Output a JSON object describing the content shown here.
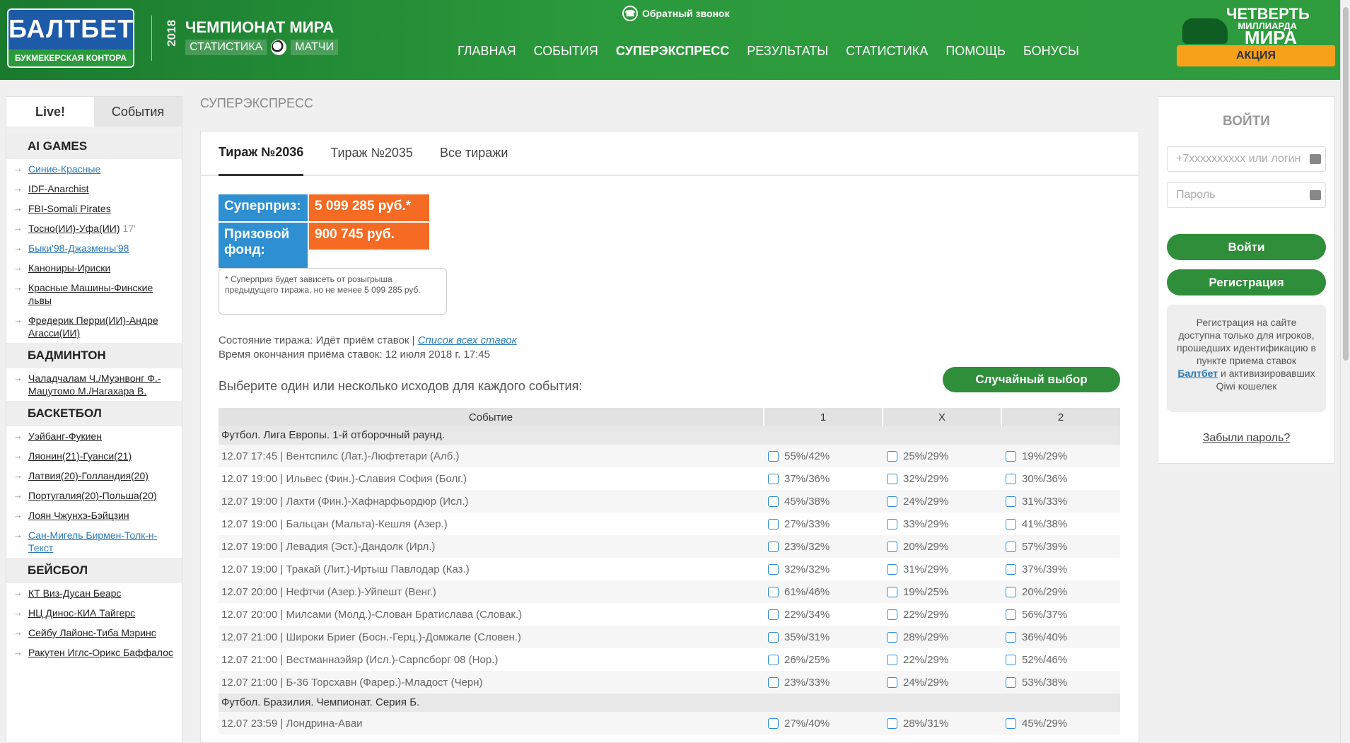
{
  "header": {
    "logo_text": "БАЛТБЕТ",
    "logo_sub": "БУКМЕКЕРСКАЯ КОНТОРА",
    "wc_year": "2018",
    "wc_title": "ЧЕМПИОНАТ МИРА",
    "wc_stats": "СТАТИСТИКА",
    "wc_matches": "МАТЧИ",
    "callback": "Обратный звонок",
    "nav": [
      "ГЛАВНАЯ",
      "СОБЫТИЯ",
      "СУПЕРЭКСПРЕСС",
      "РЕЗУЛЬТАТЫ",
      "СТАТИСТИКА",
      "ПОМОЩЬ",
      "БОНУСЫ"
    ],
    "promo_line1": "ЧЕТВЕРТЬ",
    "promo_line2": "МИЛЛИАРДА",
    "promo_line3": "МИРА",
    "promo_button": "АКЦИЯ"
  },
  "sidebar": {
    "tab_live": "Live!",
    "tab_events": "События",
    "sections": [
      {
        "title": "AI GAMES",
        "items": [
          {
            "label": "Синие-Красные",
            "live": true
          },
          {
            "label": "IDF-Anarchist"
          },
          {
            "label": "FBI-Somali Pirates"
          },
          {
            "label": "Тосно(ИИ)-Уфа(ИИ)",
            "min": "17'"
          },
          {
            "label": "Быки'98-Джазмены'98",
            "live": true
          },
          {
            "label": "Канониры-Ириски"
          },
          {
            "label": "Красные Машины-Финские львы"
          },
          {
            "label": "Фредерик Перри(ИИ)-Андре Агасси(ИИ)"
          }
        ]
      },
      {
        "title": "БАДМИНТОН",
        "items": [
          {
            "label": "Чаладчалам Ч./Муэнвонг Ф.-Мацутомо М./Нагахара В."
          }
        ]
      },
      {
        "title": "БАСКЕТБОЛ",
        "items": [
          {
            "label": "Уэйбанг-Фукиен"
          },
          {
            "label": "Ляонин(21)-Гуанси(21)"
          },
          {
            "label": "Латвия(20)-Голландия(20)"
          },
          {
            "label": "Португалия(20)-Польша(20)"
          },
          {
            "label": "Лоян Чжунхэ-Бэйцзин"
          },
          {
            "label": "Сан-Мигель Бирмен-Толк-н-Текст",
            "live": true
          }
        ]
      },
      {
        "title": "БЕЙСБОЛ",
        "items": [
          {
            "label": "КТ Виз-Дусан Беарс"
          },
          {
            "label": "НЦ Динос-КИА Тайгерс"
          },
          {
            "label": "Сейбу Лайонс-Тиба Мэринс"
          },
          {
            "label": "Ракутен Иглс-Орикс Баффалос"
          }
        ]
      }
    ]
  },
  "main": {
    "breadcrumb": "СУПЕРЭКСПРЕСС",
    "tabs": [
      "Тираж №2036",
      "Тираж №2035",
      "Все тиражи"
    ],
    "superprize_label": "Суперприз:",
    "superprize_value": "5 099 285 руб.*",
    "fund_label": "Призовой фонд:",
    "fund_value": "900 745 руб.",
    "prize_note": "* Суперприз будет зависеть от розыгрыша предыдущего тиража, но не менее 5 099 285 руб.",
    "state_text": "Состояние тиража: Идёт приём ставок | ",
    "state_link": "Список всех ставок",
    "deadline": "Время окончания приёма ставок: 12 июля 2018 г. 17:45",
    "choose_text": "Выберите один или несколько исходов для каждого события:",
    "random_button": "Случайный выбор",
    "columns": [
      "Событие",
      "1",
      "X",
      "2"
    ],
    "groups": [
      {
        "title": "Футбол. Лига Европы. 1-й отборочный раунд.",
        "rows": [
          {
            "event": "12.07 17:45 | Вентспилс (Лат.)-Люфтетари (Алб.)",
            "o1": "55%/42%",
            "ox": "25%/29%",
            "o2": "19%/29%"
          },
          {
            "event": "12.07 19:00 | Ильвес (Фин.)-Славия София (Болг.)",
            "o1": "37%/36%",
            "ox": "32%/29%",
            "o2": "30%/36%"
          },
          {
            "event": "12.07 19:00 | Лахти (Фин.)-Хафнарфьордюр (Исл.)",
            "o1": "45%/38%",
            "ox": "24%/29%",
            "o2": "31%/33%"
          },
          {
            "event": "12.07 19:00 | Бальцан (Мальта)-Кешля (Азер.)",
            "o1": "27%/33%",
            "ox": "33%/29%",
            "o2": "41%/38%"
          },
          {
            "event": "12.07 19:00 | Левадия (Эст.)-Дандолк (Ирл.)",
            "o1": "23%/32%",
            "ox": "20%/29%",
            "o2": "57%/39%"
          },
          {
            "event": "12.07 19:00 | Тракай (Лит.)-Иртыш Павлодар (Каз.)",
            "o1": "32%/32%",
            "ox": "31%/29%",
            "o2": "37%/39%"
          },
          {
            "event": "12.07 20:00 | Нефтчи (Азер.)-Уйпешт (Венг.)",
            "o1": "61%/46%",
            "ox": "19%/25%",
            "o2": "20%/29%"
          },
          {
            "event": "12.07 20:00 | Милсами (Молд.)-Слован Братислава (Словак.)",
            "o1": "22%/34%",
            "ox": "22%/29%",
            "o2": "56%/37%"
          },
          {
            "event": "12.07 21:00 | Широки Бриег (Босн.-Герц.)-Домжале (Словен.)",
            "o1": "35%/31%",
            "ox": "28%/29%",
            "o2": "36%/40%"
          },
          {
            "event": "12.07 21:00 | Вестманнаэйяр (Исл.)-Сарпсборг 08 (Нор.)",
            "o1": "26%/25%",
            "ox": "22%/29%",
            "o2": "52%/46%"
          },
          {
            "event": "12.07 21:00 | Б-36 Торсхавн (Фарер.)-Младост (Черн)",
            "o1": "23%/33%",
            "ox": "24%/29%",
            "o2": "53%/38%"
          }
        ]
      },
      {
        "title": "Футбол. Бразилия. Чемпионат. Серия Б.",
        "rows": [
          {
            "event": "12.07 23:59 | Лондрина-Аваи",
            "o1": "27%/40%",
            "ox": "28%/31%",
            "o2": "45%/29%"
          }
        ]
      }
    ]
  },
  "login": {
    "title": "ВОЙТИ",
    "login_placeholder": "+7xxxxxxxxxx или логин",
    "password_placeholder": "Пароль",
    "login_button": "Войти",
    "register_button": "Регистрация",
    "reg_note_before": "Регистрация на сайте доступна только для игроков, прошедших идентификацию в пункте приема ставок ",
    "reg_note_link": "Балтбет",
    "reg_note_after": " и активизировавших Qiwi кошелек",
    "forgot": "Забыли пароль?"
  },
  "colors": {
    "header_green": "#2b9a3c",
    "button_green": "#2f8e3a",
    "prize_blue": "#2e8fd1",
    "prize_orange": "#f56b23",
    "promo_orange": "#f7a11a"
  }
}
